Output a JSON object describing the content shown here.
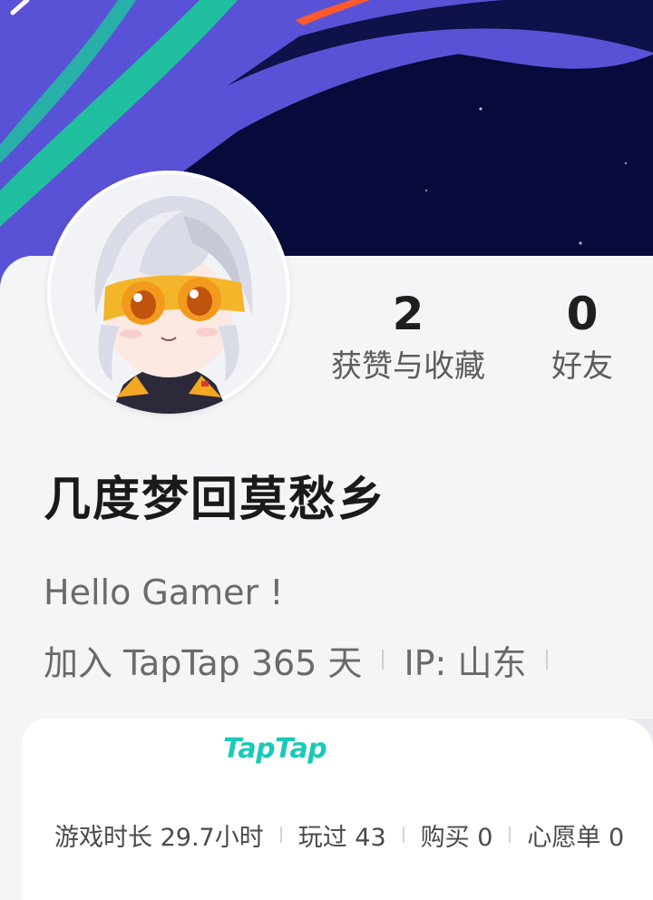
{
  "banner": {
    "colors": {
      "sky": "#070a3a",
      "purple": "#5a52d6",
      "teal": "#1fbfa0",
      "orange": "#ff5a2c"
    },
    "back_icon": "chevron-left-icon"
  },
  "profile": {
    "avatar_icon": "anime-avatar-icon",
    "stats": [
      {
        "value": "2",
        "label": "获赞与收藏"
      },
      {
        "value": "0",
        "label": "好友"
      }
    ],
    "nickname": "几度梦回莫愁乡",
    "bio": "Hello Gamer !",
    "joined": "加入 TapTap 365 天",
    "ip": "IP: 山东"
  },
  "card": {
    "logo": "TapTap",
    "accent": "#19c9b9",
    "stats": [
      "游戏时长 29.7小时",
      "玩过 43",
      "购买 0",
      "心愿单 0"
    ]
  }
}
